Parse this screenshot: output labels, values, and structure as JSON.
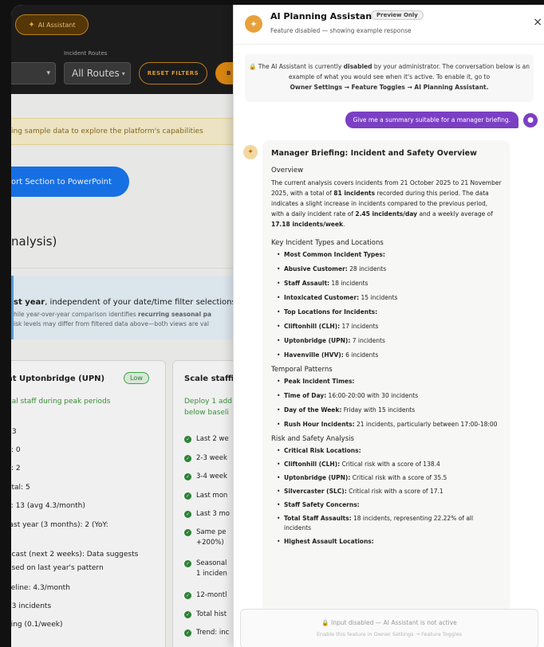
{
  "app": {
    "ai_button_label": "AI Assistant",
    "filters": {
      "incident_routes_label": "Incident Routes",
      "routes_value": "All Routes",
      "reset_label": "RESET FILTERS",
      "next_button_partial": "B"
    },
    "sample_banner": "ing sample data to explore the platform's capabilities",
    "export_button": "ort Section to PowerPoint",
    "section_title": "nalysis)",
    "info": {
      "line1_bold": "st year",
      "line1_rest": ", independent of your date/time filter selections a",
      "line2_pre": "hile year-over-year comparison identifies ",
      "line2_bold": "recurring seasonal pa",
      "line3": "isk levels may differ from filtered data above—both views are val"
    },
    "left_card": {
      "title": "at Uptonbridge (UPN)",
      "badge": "Low",
      "subtitle": "nal staff during peak periods",
      "stats": [
        ": 3",
        "c: 0",
        "c: 2",
        "otal: 5",
        "s: 13 (avg 4.3/month)",
        " last year (3 months): 2 (YoY:",
        "ecast (next 2 weeks): Data suggests",
        "ased on last year's pattern",
        "seline: 4.3/month",
        "83 incidents",
        "sing (0.1/week)"
      ]
    },
    "right_card": {
      "title": "Scale staffi",
      "subtitle_line1": "Deploy 1 add",
      "subtitle_line2": "below baseli",
      "checks": [
        "Last 2 we",
        "2-3 week",
        "3-4 week",
        "Last mon",
        "Last 3 mo",
        "Same pe",
        "+200%)",
        "Seasonal",
        "1 inciden",
        "12-montl",
        "Total hist",
        "Trend: inc"
      ]
    }
  },
  "panel": {
    "title": "AI Planning Assistant",
    "badge": "Preview Only",
    "subtitle": "Feature disabled — showing example response",
    "close_label": "×",
    "notice": {
      "pre": "The AI Assistant is currently ",
      "bold": "disabled",
      "post": " by your administrator. The conversation below is an example of what you would see when it's active. To enable it, go to",
      "path": "Owner Settings → Feature Toggles → AI Planning Assistant."
    },
    "user_message": "Give me a summary suitable for a manager briefing.",
    "response": {
      "title": "Manager Briefing: Incident and Safety Overview",
      "overview_heading": "Overview",
      "overview": {
        "t1": "The current analysis covers incidents from 21 October 2025 to 21 November 2025, with a total of ",
        "b1": "81 incidents",
        "t2": " recorded during this period. The data indicates a slight increase in incidents compared to the previous period, with a daily incident rate of ",
        "b2": "2.45 incidents/day",
        "t3": " and a weekly average of ",
        "b3": "17.18 incidents/week",
        "t4": "."
      },
      "key_heading": "Key Incident Types and Locations",
      "key_items": [
        {
          "b": "Most Common Incident Types:",
          "t": ""
        },
        {
          "b": "Abusive Customer:",
          "t": " 28 incidents"
        },
        {
          "b": "Staff Assault:",
          "t": " 18 incidents"
        },
        {
          "b": "Intoxicated Customer:",
          "t": " 15 incidents"
        },
        {
          "b": "Top Locations for Incidents:",
          "t": ""
        },
        {
          "b": "Cliftonhill (CLH):",
          "t": " 17 incidents"
        },
        {
          "b": "Uptonbridge (UPN):",
          "t": " 7 incidents"
        },
        {
          "b": "Havenville (HVV):",
          "t": " 6 incidents"
        }
      ],
      "temporal_heading": "Temporal Patterns",
      "temporal_items": [
        {
          "b": "Peak Incident Times:",
          "t": ""
        },
        {
          "b": "Time of Day:",
          "t": " 16:00-20:00 with 30 incidents"
        },
        {
          "b": "Day of the Week:",
          "t": " Friday with 15 incidents"
        },
        {
          "b": "Rush Hour Incidents:",
          "t": " 21 incidents, particularly between 17:00-18:00"
        }
      ],
      "risk_heading": "Risk and Safety Analysis",
      "risk_items": [
        {
          "b": "Critical Risk Locations:",
          "t": ""
        },
        {
          "b": "Cliftonhill (CLH):",
          "t": " Critical risk with a score of 138.4"
        },
        {
          "b": "Uptonbridge (UPN):",
          "t": " Critical risk with a score of 35.5"
        },
        {
          "b": "Silvercaster (SLC):",
          "t": " Critical risk with a score of 17.1"
        },
        {
          "b": "Staff Safety Concerns:",
          "t": ""
        },
        {
          "b": "Total Staff Assaults:",
          "t": " 18 incidents, representing 22.22% of all incidents"
        },
        {
          "b": "Highest Assault Locations:",
          "t": ""
        }
      ]
    },
    "input": {
      "line1": "Input disabled — AI Assistant is not active",
      "line2": "Enable this feature in Owner Settings → Feature Toggles"
    }
  }
}
